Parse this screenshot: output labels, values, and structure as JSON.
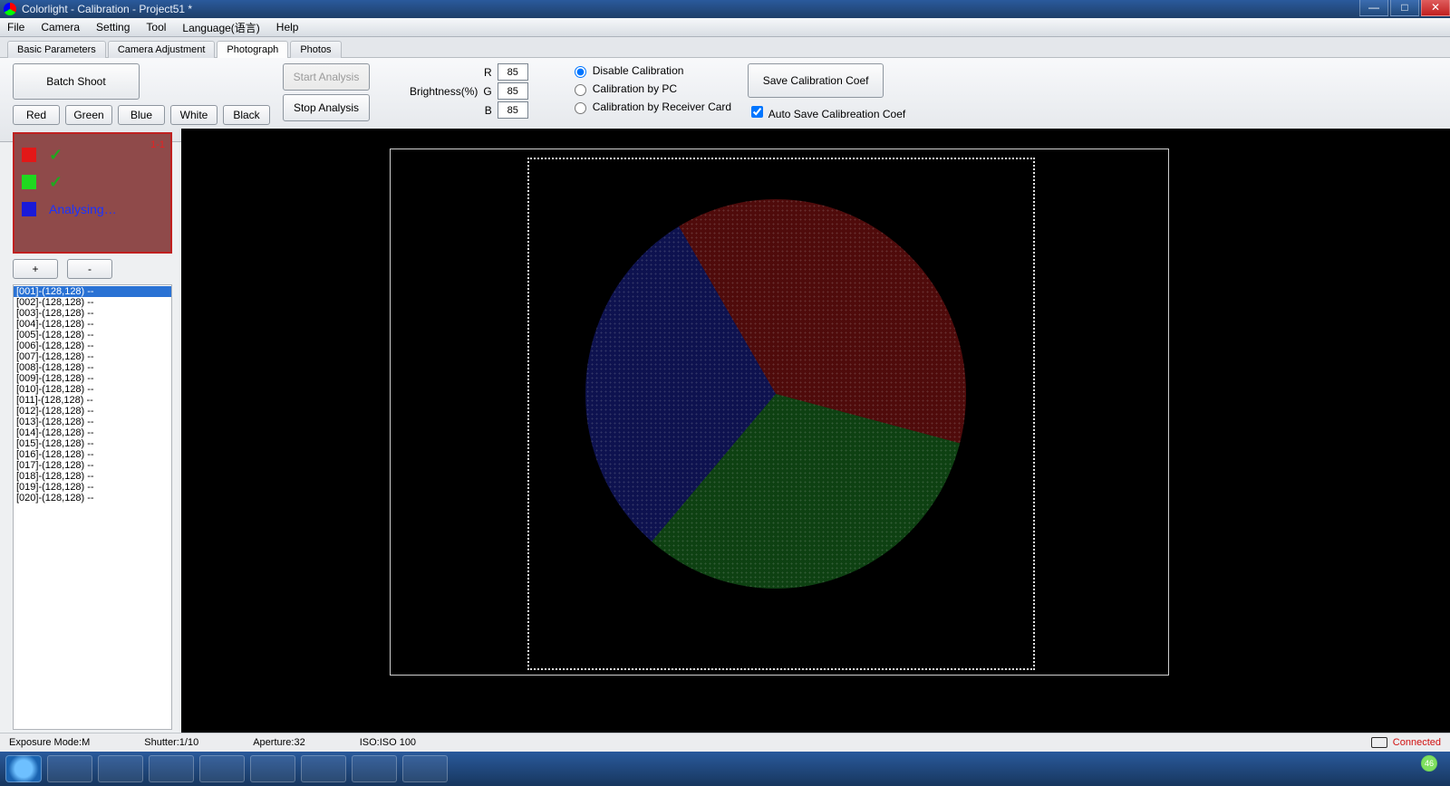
{
  "window": {
    "title": "Colorlight - Calibration        - Project51 *"
  },
  "menu": [
    "File",
    "Camera",
    "Setting",
    "Tool",
    "Language(语言)",
    "Help"
  ],
  "tabs": {
    "items": [
      "Basic Parameters",
      "Camera Adjustment",
      "Photograph",
      "Photos"
    ],
    "active_index": 2
  },
  "controls": {
    "batch_shoot": "Batch Shoot",
    "start_analysis": "Start Analysis",
    "stop_analysis": "Stop Analysis",
    "color_buttons": [
      "Red",
      "Green",
      "Blue",
      "White",
      "Black"
    ],
    "brightness_label": "Brightness(%)",
    "brightness": {
      "R": "85",
      "G": "85",
      "B": "85"
    },
    "calibration_options": {
      "disable": "Disable Calibration",
      "by_pc": "Calibration by PC",
      "by_card": "Calibration by Receiver Card",
      "selected": "disable"
    },
    "save_coef": "Save Calibration Coef",
    "auto_save": {
      "label": "Auto Save Calibreation Coef",
      "checked": true
    }
  },
  "status_pane": {
    "corner": "1-1",
    "rows": {
      "red": {
        "state": "done"
      },
      "green": {
        "state": "done"
      },
      "blue": {
        "state": "analysing",
        "text": "Analysing…"
      }
    }
  },
  "plusminus": {
    "plus": "+",
    "minus": "-"
  },
  "file_list": {
    "selected_index": 0,
    "items": [
      "[001]-(128,128) --",
      "[002]-(128,128) --",
      "[003]-(128,128) --",
      "[004]-(128,128) --",
      "[005]-(128,128) --",
      "[006]-(128,128) --",
      "[007]-(128,128) --",
      "[008]-(128,128) --",
      "[009]-(128,128) --",
      "[010]-(128,128) --",
      "[011]-(128,128) --",
      "[012]-(128,128) --",
      "[013]-(128,128) --",
      "[014]-(128,128) --",
      "[015]-(128,128) --",
      "[016]-(128,128) --",
      "[017]-(128,128) --",
      "[018]-(128,128) --",
      "[019]-(128,128) --",
      "[020]-(128,128) --"
    ]
  },
  "status_bar": {
    "exposure": "Exposure Mode:M",
    "shutter": "Shutter:1/10",
    "aperture": "Aperture:32",
    "iso": "ISO:ISO 100",
    "connected": "Connected"
  },
  "taskbar": {
    "badge": "46"
  }
}
